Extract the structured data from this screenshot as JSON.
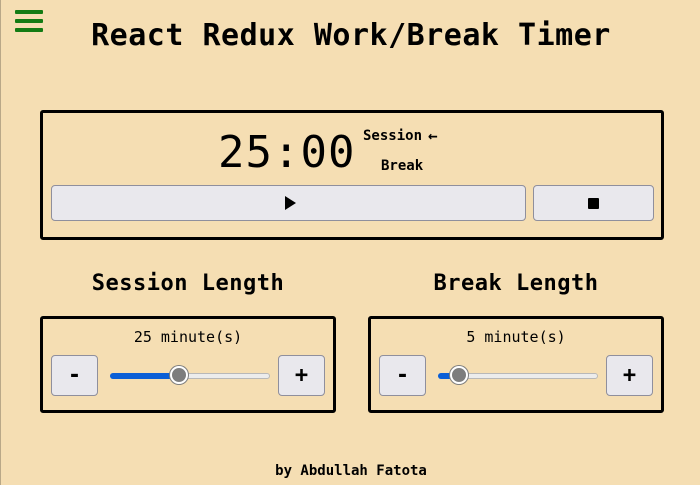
{
  "header": {
    "title": "React Redux Work/Break Timer",
    "menu_icon": "hamburger-menu-icon",
    "menu_color": "#137b13"
  },
  "timer": {
    "time": "25:00",
    "session_label": "Session",
    "break_label": "Break",
    "active_indicator_icon": "arrow-left-icon",
    "active_mode": "Session",
    "play_icon": "play-icon",
    "stop_icon": "stop-icon"
  },
  "session": {
    "label": "Session Length",
    "minutes_text": "25 minute(s)",
    "decrement_label": "-",
    "increment_label": "+",
    "slider_fraction": 0.43
  },
  "break": {
    "label": "Break Length",
    "minutes_text": "5 minute(s)",
    "decrement_label": "-",
    "increment_label": "+",
    "slider_fraction": 0.13
  },
  "footer": {
    "text": "by Abdullah Fatota"
  },
  "colors": {
    "background": "#f5deb3",
    "slider_accent": "#0b5fd6"
  }
}
